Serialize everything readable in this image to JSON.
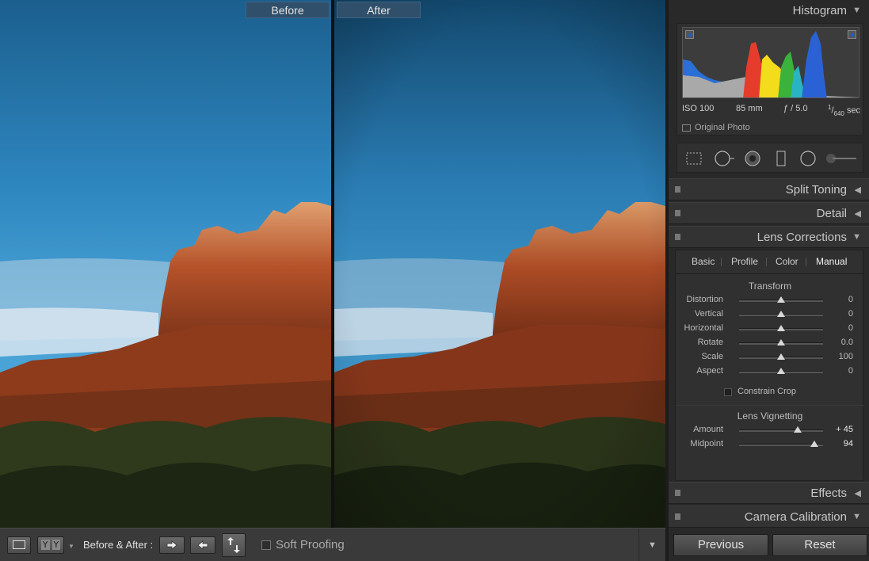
{
  "view": {
    "before_label": "Before",
    "after_label": "After"
  },
  "toolbar": {
    "yy_label_left": "Y",
    "yy_label_right": "Y",
    "before_after_label": "Before & After :",
    "soft_proofing_label": "Soft Proofing"
  },
  "histogram": {
    "title": "Histogram",
    "iso": "ISO 100",
    "focal_length": "85 mm",
    "aperture": "ƒ / 5.0",
    "shutter_num": "1",
    "shutter_den": "640",
    "shutter_unit": "sec",
    "original_photo_label": "Original Photo"
  },
  "panels": {
    "split_toning": "Split Toning",
    "detail": "Detail",
    "lens_corrections": "Lens Corrections",
    "effects": "Effects",
    "camera_calibration": "Camera Calibration"
  },
  "lens_corrections": {
    "tabs": [
      "Basic",
      "Profile",
      "Color",
      "Manual"
    ],
    "active_tab": "Manual",
    "transform_title": "Transform",
    "transform_sliders": [
      {
        "label": "Distortion",
        "value": "0",
        "fraction": 0.5
      },
      {
        "label": "Vertical",
        "value": "0",
        "fraction": 0.5
      },
      {
        "label": "Horizontal",
        "value": "0",
        "fraction": 0.5
      },
      {
        "label": "Rotate",
        "value": "0.0",
        "fraction": 0.5
      },
      {
        "label": "Scale",
        "value": "100",
        "fraction": 0.5
      },
      {
        "label": "Aspect",
        "value": "0",
        "fraction": 0.5
      }
    ],
    "constrain_crop_label": "Constrain Crop",
    "vignetting_title": "Lens Vignetting",
    "vignetting_sliders": [
      {
        "label": "Amount",
        "value": "+ 45",
        "fraction": 0.7
      },
      {
        "label": "Midpoint",
        "value": "94",
        "fraction": 0.9
      }
    ]
  },
  "buttons": {
    "previous": "Previous",
    "reset": "Reset"
  }
}
